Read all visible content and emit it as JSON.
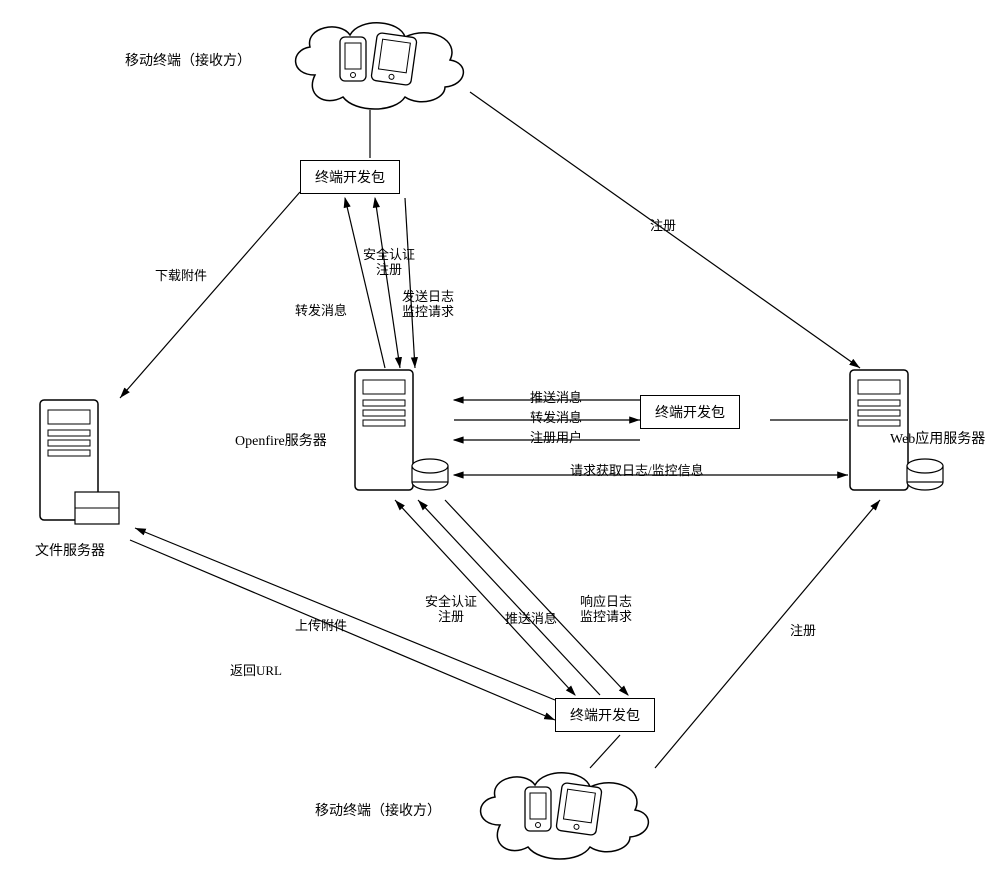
{
  "nodes": {
    "mobile_receiver_top": "移动终端（接收方）",
    "mobile_receiver_bottom": "移动终端（接收方）",
    "sdk_top": "终端开发包",
    "sdk_bottom": "终端开发包",
    "sdk_right": "终端开发包",
    "openfire": "Openfire服务器",
    "file_server": "文件服务器",
    "web_server": "Web应用服务器"
  },
  "edges": {
    "download_attachment": "下载附件",
    "register_top_right": "注册",
    "forward_msg_top": "转发消息",
    "security_auth_register_top": {
      "line1": "安全认证",
      "line2": "注册"
    },
    "send_log_monitor_req": {
      "line1": "发送日志",
      "line2": "监控请求"
    },
    "push_msg_right": "推送消息",
    "forward_msg_right": "转发消息",
    "register_user": "注册用户",
    "request_log_monitor": "请求获取日志/监控信息",
    "upload_attachment": "上传附件",
    "return_url": "返回URL",
    "security_auth_register_bottom": {
      "line1": "安全认证",
      "line2": "注册"
    },
    "push_msg_bottom": "推送消息",
    "respond_log_monitor": {
      "line1": "响应日志",
      "line2": "监控请求"
    },
    "register_bottom_right": "注册"
  }
}
